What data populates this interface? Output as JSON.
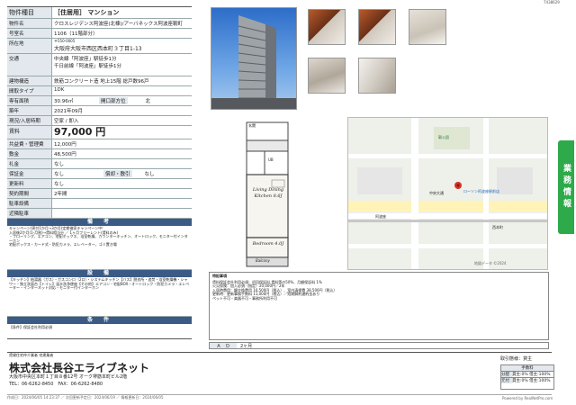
{
  "header": {
    "code": "7438629"
  },
  "property": {
    "kind_label": "物件種目",
    "kind_value": "［住居用］ マンション",
    "name_label": "物件名",
    "name_value": "クロスレジデンス阿波座(北棟)/アーバネックス阿波座靭町",
    "room_label": "号室名",
    "room_value": "1106（11階部分）",
    "address_label": "所在地",
    "address_zip": "〒550-0005",
    "address_value": "大阪府大阪市西区西本町３丁目1-13",
    "traffic_label": "交通",
    "traffic_1": "中央線「阿波座」駅徒歩1分",
    "traffic_2": "千日前線「阿波座」駅徒歩1分",
    "structure_label": "建物構造",
    "structure_value": "鉄筋コンクリート造 地上15階 総戸数96戸",
    "layout_label": "間取タイプ",
    "layout_value": "1DK",
    "area_label": "専有面積",
    "area_value": "30.96㎡",
    "direction_label": "開口部方位",
    "direction_value": "北",
    "built_label": "築年",
    "built_value": "2021年09月",
    "current_label": "現況/入居時期",
    "current_value": "空家 / 即入",
    "rent_label": "賃料",
    "rent_value": "97,000 円",
    "mgmt_label": "共益費・管理費",
    "mgmt_value": "12,000円",
    "deposit_label": "敷金",
    "deposit_value": "48,500円",
    "key_label": "礼金",
    "key_value": "なし",
    "hoshou_label": "保証金",
    "hoshou_value": "なし",
    "shokyaku_label": "償却・敷引",
    "shokyaku_value": "なし",
    "renew_label": "更新料",
    "renew_value": "なし",
    "contract_label": "契約期間",
    "contract_value": "2年間",
    "kind2_label": "駐車設備",
    "kind2_value": "",
    "neighbor_label": "近隣駐車",
    "neighbor_value": ""
  },
  "bikou": {
    "title": "備　考",
    "text": "キャンペーン(寄付1か月→3か月)定期借家キャンペーン中!\n入居後2か月(1-月割)→賃料相当分 ／ 1ヶ月フリーレント(賃料のみ)\n・フローリング、エアコン、宅配ボックス、浴室乾燥、カウンターキッチン、オートロック、モニター付インターホン\n宅配ボックス・カード式・防犯カメラ、エレベーター、ゴミ置き場"
  },
  "setsubi": {
    "title": "設　備",
    "text": "【キッチン】給湯器（ガス）・ガスコンロ（2口）・システムキッチン【バス】脱衣所・追焚・浴室乾燥機・シャワー・独立洗面台【トイレ】温水洗浄便座【その他】エアコン・宅配BOX・オートロック・防犯カメラ・エレベーター・インターネット対応・モニター付インターホン"
  },
  "jouken": {
    "title": "条　件",
    "text": "【条件】保証会社利用必須"
  },
  "floorplan": {
    "balcony": "Balcony",
    "living": "Living Dining Kitchen 8.6J",
    "bedroom": "Bedroom 4.0J",
    "bath": "UB",
    "entrance": "玄関"
  },
  "map": {
    "copyright": "地図データ ©2024",
    "labels": [
      "中央大通",
      "阿波座",
      "ローソン阿波座駅前店",
      "靭公園",
      "西本町"
    ]
  },
  "notes": {
    "title": "特記事項",
    "text": "賃料保証会社利用必須：初回保証料 賃料等の50%、月額保証料 1%\n火災保険：加入必須（指定）20,000円／2年\n入居時費用：鍵交換費用 16,500円（税込）、室内清掃費 38,500円（税込）\n更新時：更新事務手数料 11,000円（税込）／短期解約違約金あり\nペット不可・楽器不可・事務所利用不可"
  },
  "lower": {
    "ad_label": "Ａ　Ｄ",
    "ad_value": "2ヶ月"
  },
  "footer": {
    "tagline": "賃貸住宅仲介業者 宅建業者",
    "company": "株式会社長谷エライブネット",
    "address": "大阪市中央区本町１丁目８番12号 オーク堺筋本町ビル2階",
    "contact": "TEL：06-6262-8450　FAX：06-6262-8480",
    "dealtype_label": "取引態様：",
    "dealtype_value": "貸主",
    "fee_title": "手数料",
    "fee_row1_label": "分配",
    "fee_row1_value": "貸主:0% 借主:100%",
    "fee_row2_label": "元付",
    "fee_row2_value": "貸主:0% 借主:100%",
    "print_date": "作成日：2024/06/05 14:23:37 ／ 次回更新予定日：2024/06/19 ／ 情報更新日：2024/06/05",
    "powered": "Powered by RealNetPro.com"
  },
  "sidebar": {
    "label": "業務情報"
  },
  "colors": {
    "accent": "#3b5b86",
    "sidebar": "#2eaa4a",
    "brand_red": "#c62828"
  }
}
